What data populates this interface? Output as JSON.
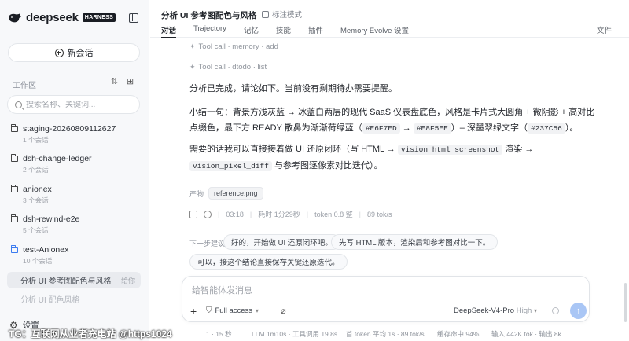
{
  "brand": {
    "name": "deepseek",
    "badge": "HARNESS"
  },
  "sidebar": {
    "new_chat": "新会话",
    "workspace_title": "工作区",
    "search_placeholder": "搜索名称、关键词...",
    "projects": [
      {
        "name": "staging-20260809112627",
        "count": "1 个会话"
      },
      {
        "name": "dsh-change-ledger",
        "count": "2 个会话"
      },
      {
        "name": "anionex",
        "count": "3 个会话"
      },
      {
        "name": "dsh-rewind-e2e",
        "count": "5 个会话"
      },
      {
        "name": "test-Anionex",
        "count": "10 个会话"
      }
    ],
    "chats": [
      {
        "title": "分析 UI 参考图配色与风格",
        "meta": "给你"
      },
      {
        "title": "分析 UI 配色风格",
        "meta": ""
      }
    ],
    "settings": "设置"
  },
  "topbar": {
    "title": "分析 UI 参考图配色与风格",
    "mark_mode": "标注模式",
    "tabs": [
      "对话",
      "Trajectory",
      "记忆",
      "技能",
      "插件",
      "Memory Evolve 设置"
    ],
    "files_tab": "文件"
  },
  "messages": {
    "tool1": "Tool call · memory · add",
    "tool2": "Tool call · dtodo · list",
    "p1": "分析已完成，请论如下。当前没有剩期待办需要提醒。",
    "p2a": "小结一句：背景方浅灰蓝 → 冰蓝白两层的现代 SaaS 仪表盘底色，风格是卡片式大圆角 + 微阴影 + 高对比点缀色，最下方 READY 散鼻为渐渐荷绿蓝（",
    "p2_code1": "#E6F7ED",
    "p2_arrow": "→",
    "p2_code2": "#E8F5EE",
    "p2b": "）– 深墨翠绿文字（",
    "p2_code3": "#237C56",
    "p2c": "）。",
    "p3a": "需要的话我可以直接接着做 UI 还原闭环（写 HTML →",
    "p3_code1": "vision_html_screenshot",
    "p3b": "渲染 →",
    "p3_code2": "vision_pixel_diff",
    "p3c": "与参考图逐像素对比迭代）。"
  },
  "artifacts": {
    "label": "产物",
    "file": "reference.png"
  },
  "stats": {
    "time": "03:18",
    "duration": "耗时 1分29秒",
    "tokens": "token 0.8 整",
    "speed": "89 tok/s"
  },
  "suggestions": {
    "label": "下一步建议",
    "items": [
      "好的，开始做 UI 还原闭环吧。",
      "先写 HTML 版本，渲染后和参考图对比一下。",
      "可以，接这个结论直接保存关键还原迭代。"
    ]
  },
  "composer": {
    "placeholder": "给智能体发消息",
    "access": "Full access",
    "model": "DeepSeek-V4-Pro",
    "level": "High"
  },
  "statusbar": {
    "watermark": "TG：互联网从业者充电站 @https1024",
    "items": [
      "1 · 15 秒",
      "LLM 1m10s · 工具调用 19.8s",
      "首 token 平均 1s · 89 tok/s",
      "缓存命中 94%",
      "输入 442K tok · 输出 8k"
    ]
  }
}
